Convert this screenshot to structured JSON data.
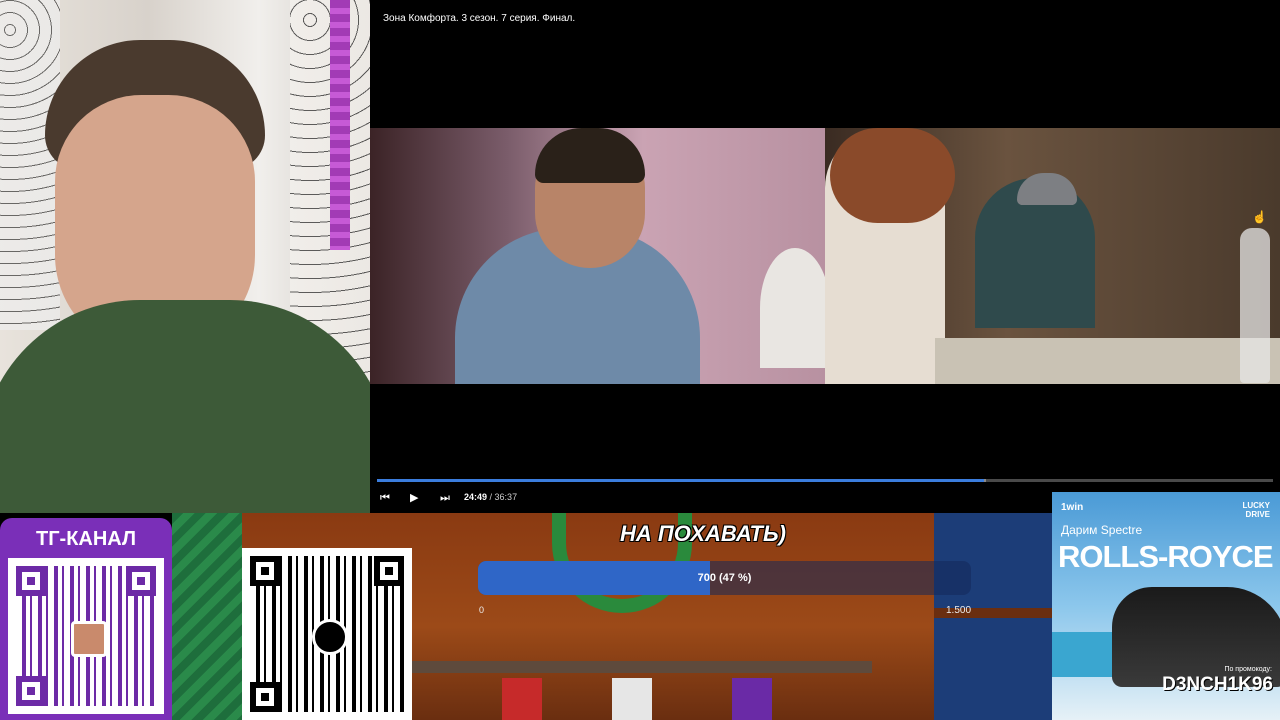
{
  "player": {
    "video_title": "Зона Комфорта. 3 сезон. 7 серия. Финал.",
    "time_current": "24:49",
    "time_separator": " / ",
    "time_total": "36:37",
    "progress": 0.678,
    "buffered": 0.68,
    "prev_icon": "⏮",
    "play_icon": "▶",
    "next_icon": "⏭",
    "accent_color": "#3b7ddd"
  },
  "telegram": {
    "title": "ТГ-КАНАЛ"
  },
  "donation_goal": {
    "banner_text": "НА ПОХАВАТЬ)",
    "label": "700 (47 %)",
    "fraction": 0.47,
    "min_label": "0",
    "max_label": "1.500"
  },
  "ad": {
    "brand": "1win",
    "partner": "LUCKY DRIVE",
    "line1": "Дарим Spectre",
    "line2": "ROLLS-ROYCE",
    "promo_label": "По промокоду:",
    "promo_code": "D3NCH1K96"
  }
}
